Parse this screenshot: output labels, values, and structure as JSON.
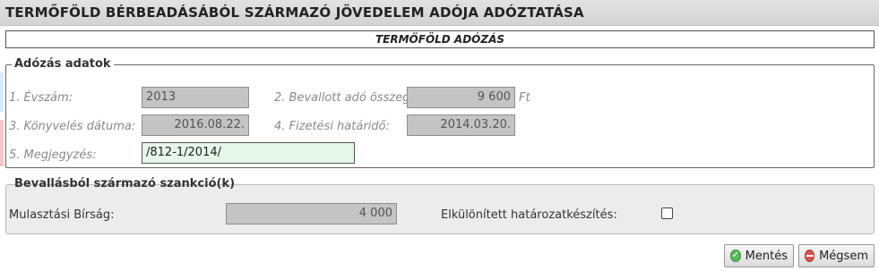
{
  "header": {
    "title": "TERMŐFÖLD BÉRBEADÁSÁBÓL SZÁRMAZÓ JÖVEDELEM ADÓJA ADÓZTATÁSA",
    "subtitle": "TERMŐFÖLD ADÓZÁS"
  },
  "adozas": {
    "legend": "Adózás adatok",
    "fields": {
      "evszam": {
        "label": "1. Évszám:",
        "value": "2013"
      },
      "bevallott_ado": {
        "label": "2. Bevallott adó összeg:",
        "value": "9 600",
        "unit": "Ft"
      },
      "konyveles_datuma": {
        "label": "3. Könyvelés dátuma:",
        "value": "2016.08.22."
      },
      "fizetesi_hatarido": {
        "label": "4. Fizetési határidő:",
        "value": "2014.03.20."
      },
      "megjegyzes": {
        "label": "5. Megjegyzés:",
        "value": "/812-1/2014/"
      }
    }
  },
  "szankcio": {
    "legend": "Bevallásból származó szankció(k)",
    "mulasztasi_birsag": {
      "label": "Mulasztási Bírság:",
      "value": "4 000"
    },
    "elkulonitett": {
      "label": "Elkülönített határozatkészítés:",
      "checked": false
    }
  },
  "buttons": {
    "save": {
      "label": "Mentés",
      "icon": "check-circle-icon"
    },
    "cancel": {
      "label": "Mégsem",
      "icon": "minus-circle-icon"
    }
  }
}
